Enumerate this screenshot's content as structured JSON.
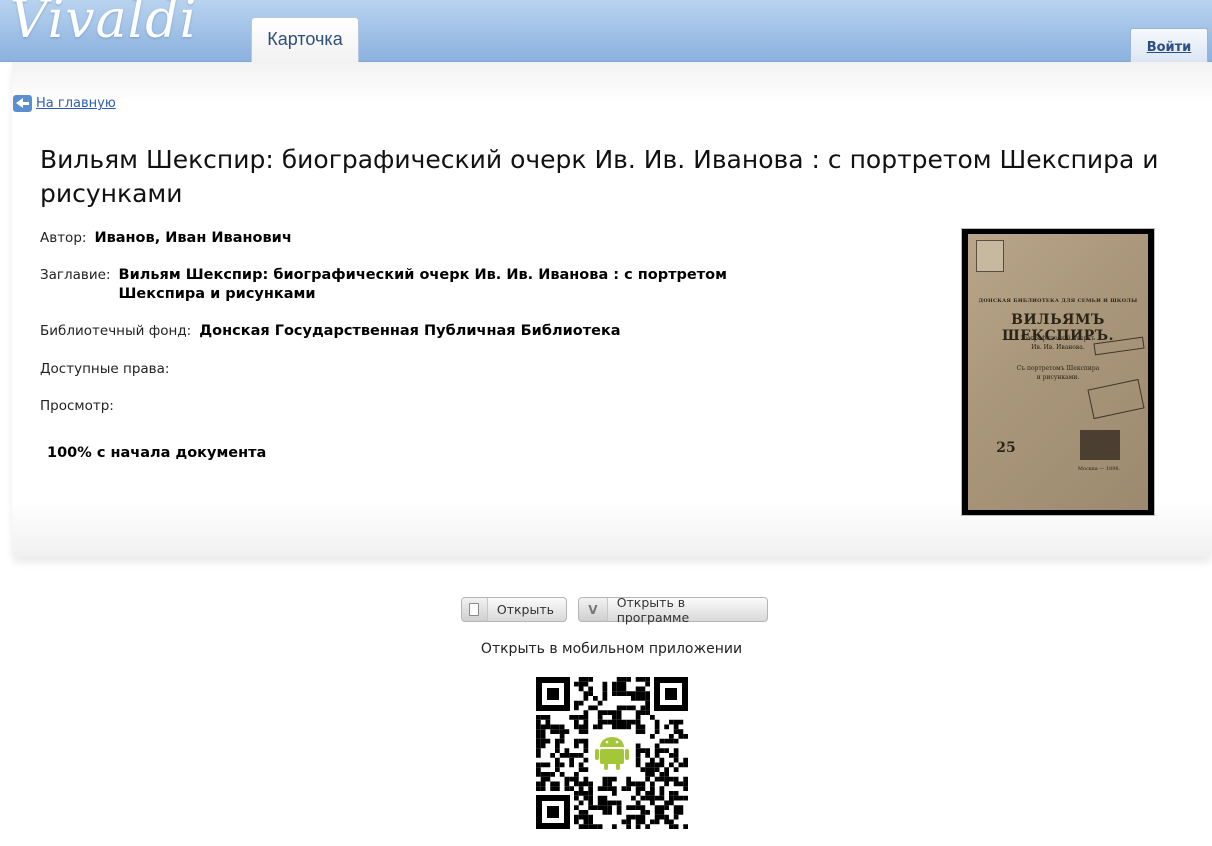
{
  "header": {
    "logo": "Vivaldi",
    "tab_label": "Карточка",
    "login_label": "Войти"
  },
  "nav": {
    "back_label": "На главную"
  },
  "record": {
    "title": "Вильям Шекспир: биографический очерк Ив. Ив. Иванова : с портретом Шекспира и рисунками",
    "fields": {
      "author_label": "Автор:",
      "author_value": "Иванов, Иван Иванович",
      "title_label": "Заглавие:",
      "title_value": "Вильям Шекспир: биографический очерк Ив. Ив. Иванова : с портретом Шекспира и рисунками",
      "fund_label": "Библиотечный фонд:",
      "fund_value": "Донская Государственная Публичная Библиотека",
      "rights_label": "Доступные права:",
      "rights_value": "",
      "view_label": "Просмотр:",
      "view_value": ""
    },
    "progress_text": "100% с начала документа"
  },
  "cover": {
    "header_line": "ДОНСКАЯ БИБЛИОТЕКА ДЛЯ СЕМЬИ И ШКОЛЫ",
    "name": "ВИЛЬЯМЪ ШЕКСПИРЪ.",
    "subtitle_1": "Біографическій очеркъ",
    "subtitle_2": "Ив. Ив. Иванова.",
    "portrait_1": "Съ портретомъ Шекспира",
    "portrait_2": "и рисунками.",
    "shelf_number": "25",
    "place_year": "Москва — 1898."
  },
  "actions": {
    "open_label": "Открыть",
    "open_app_label": "Открыть в программе",
    "open_app_icon": "V",
    "mobile_label": "Открыть в мобильном приложении"
  },
  "qr": {
    "center_icon": "android-icon"
  }
}
